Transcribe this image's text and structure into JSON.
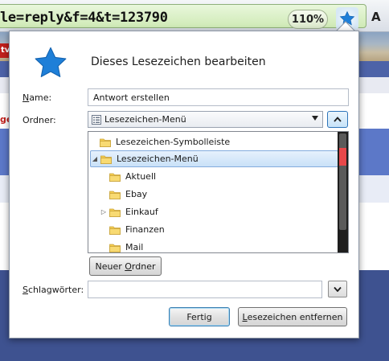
{
  "browser": {
    "url_text": "le=reply&f=4&t=123790",
    "zoom_label": "110%",
    "toolbar_letter": "A",
    "bookmark_star_color": "#1e7fd8"
  },
  "background": {
    "red_chip_text": "tv",
    "red_side_text": "ge"
  },
  "panel": {
    "title": "Dieses Lesezeichen bearbeiten",
    "name_label_accel": "N",
    "name_label_rest": "ame:",
    "name_value": "Antwort erstellen",
    "folder_label": "Ordner:",
    "folder_selected": "Lesezeichen-Menü",
    "tags_label_accel": "S",
    "tags_label_rest": "chlagwörter:",
    "tags_value": ""
  },
  "tree": {
    "items": [
      {
        "label": "Lesezeichen-Symbolleiste",
        "twisty": ""
      },
      {
        "label": "Lesezeichen-Menü",
        "twisty": "◢"
      },
      {
        "label": "Aktuell",
        "twisty": ""
      },
      {
        "label": "Ebay",
        "twisty": ""
      },
      {
        "label": "Einkauf",
        "twisty": "▷"
      },
      {
        "label": "Finanzen",
        "twisty": ""
      },
      {
        "label": "Mail",
        "twisty": ""
      }
    ]
  },
  "buttons": {
    "new_folder_pre": "Neuer ",
    "new_folder_accel": "O",
    "new_folder_post": "rdner",
    "done": "Fertig",
    "remove_accel": "L",
    "remove_rest": "esezeichen entfernen"
  },
  "colors": {
    "folder_yellow": "#f5cd4f",
    "selected_row": "#c9e1f8",
    "url_green": "#cfeab6"
  }
}
